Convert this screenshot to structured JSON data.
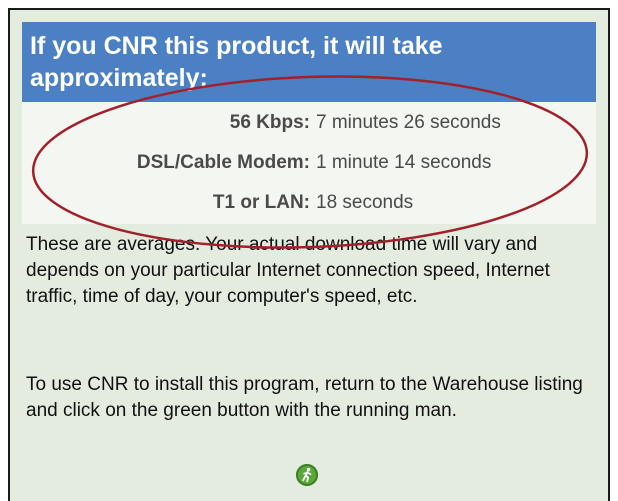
{
  "header": {
    "title": "If you CNR this product, it will take approximately:"
  },
  "download_times": [
    {
      "label": "56 Kbps:",
      "value": "7 minutes 26 seconds"
    },
    {
      "label": "DSL/Cable Modem:",
      "value": "1 minute 14 seconds"
    },
    {
      "label": "T1 or LAN:",
      "value": "18 seconds"
    }
  ],
  "notes": {
    "averages": "These are averages. Your actual download time will vary and depends on your particular Internet connection speed, Internet traffic, time of day, your computer's speed, etc.",
    "instructions": "To use CNR to install this program, return to the Warehouse listing and click on the green button with the running man."
  },
  "icons": {
    "cnr_button": "running-man-icon"
  },
  "colors": {
    "header_bg": "#4b81c4",
    "panel_bg": "#e4ecdf",
    "highlight_oval": "#a3202a",
    "cnr_button": "#5aa83a"
  }
}
